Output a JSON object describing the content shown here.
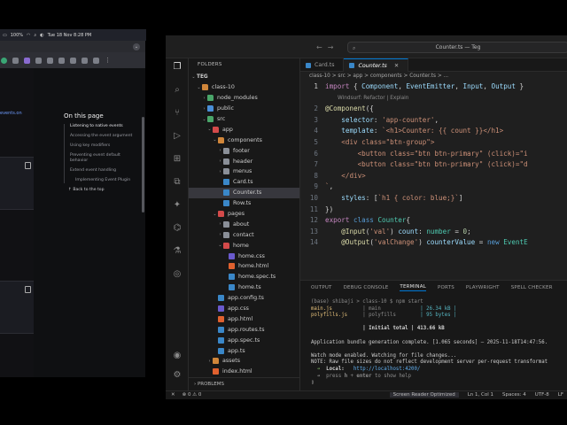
{
  "mac_menubar": {
    "date": "Tue 18 Nov 8:28 PM",
    "battery": "100%"
  },
  "browser": {
    "page_link_text": "events.on",
    "toc_title": "On this page",
    "toc_items": [
      {
        "label": "Listening to native events",
        "active": true,
        "sub": false
      },
      {
        "label": "Accessing the event argument",
        "active": false,
        "sub": false
      },
      {
        "label": "Using key modifiers",
        "active": false,
        "sub": false
      },
      {
        "label": "Preventing event default behavior",
        "active": false,
        "sub": false
      },
      {
        "label": "Extend event handling",
        "active": false,
        "sub": false
      },
      {
        "label": "Implementing Event Plugin",
        "active": false,
        "sub": true
      }
    ],
    "back_to_top": "Back to the top"
  },
  "vscode": {
    "window_title": "Counter.ts — Teg",
    "explorer": {
      "header": "FOLDERS",
      "root": "TEG",
      "problems_header": "PROBLEMS",
      "tree": [
        {
          "label": "class-10",
          "depth": 1,
          "type": "folder",
          "color": "orange",
          "open": true
        },
        {
          "label": "node_modules",
          "depth": 2,
          "type": "folder",
          "color": "green",
          "open": false
        },
        {
          "label": "public",
          "depth": 2,
          "type": "folder",
          "color": "blue",
          "open": false
        },
        {
          "label": "src",
          "depth": 2,
          "type": "folder",
          "color": "green",
          "open": true
        },
        {
          "label": "app",
          "depth": 3,
          "type": "folder",
          "color": "red",
          "open": true
        },
        {
          "label": "components",
          "depth": 4,
          "type": "folder",
          "color": "orange",
          "open": true
        },
        {
          "label": "footer",
          "depth": 5,
          "type": "folder",
          "color": "gray",
          "open": false
        },
        {
          "label": "header",
          "depth": 5,
          "type": "folder",
          "color": "gray",
          "open": false
        },
        {
          "label": "menus",
          "depth": 5,
          "type": "folder",
          "color": "gray",
          "open": false
        },
        {
          "label": "Card.ts",
          "depth": 5,
          "type": "ts"
        },
        {
          "label": "Counter.ts",
          "depth": 5,
          "type": "ts",
          "selected": true
        },
        {
          "label": "Row.ts",
          "depth": 5,
          "type": "ts"
        },
        {
          "label": "pages",
          "depth": 4,
          "type": "folder",
          "color": "red",
          "open": true
        },
        {
          "label": "about",
          "depth": 5,
          "type": "folder",
          "color": "gray",
          "open": false
        },
        {
          "label": "contact",
          "depth": 5,
          "type": "folder",
          "color": "gray",
          "open": false
        },
        {
          "label": "home",
          "depth": 5,
          "type": "folder",
          "color": "red",
          "open": true
        },
        {
          "label": "home.css",
          "depth": 6,
          "type": "css"
        },
        {
          "label": "home.html",
          "depth": 6,
          "type": "html"
        },
        {
          "label": "home.spec.ts",
          "depth": 6,
          "type": "ts"
        },
        {
          "label": "home.ts",
          "depth": 6,
          "type": "ts"
        },
        {
          "label": "app.config.ts",
          "depth": 4,
          "type": "ts"
        },
        {
          "label": "app.css",
          "depth": 4,
          "type": "css"
        },
        {
          "label": "app.html",
          "depth": 4,
          "type": "html"
        },
        {
          "label": "app.routes.ts",
          "depth": 4,
          "type": "ts"
        },
        {
          "label": "app.spec.ts",
          "depth": 4,
          "type": "ts"
        },
        {
          "label": "app.ts",
          "depth": 4,
          "type": "ts"
        },
        {
          "label": "assets",
          "depth": 3,
          "type": "folder",
          "color": "orange",
          "open": false
        },
        {
          "label": "index.html",
          "depth": 3,
          "type": "html"
        }
      ]
    },
    "tabs": [
      {
        "label": "Card.ts",
        "active": false
      },
      {
        "label": "Counter.ts",
        "active": true
      }
    ],
    "breadcrumbs": "class-10 > src > app > components > Counter.ts > ...",
    "codelens": "Windsurf: Refactor | Explain",
    "code_lines": [
      {
        "n": "1",
        "html": "<span class='kw2'>import</span> { <span class='pr'>Component</span>, <span class='pr'>EventEmitter</span>, <span class='pr'>Input</span>, <span class='pr'>Output</span> }"
      },
      {
        "n": "",
        "codelens": true
      },
      {
        "n": "2",
        "html": "<span class='dec'>@Component</span>({"
      },
      {
        "n": "3",
        "html": "    <span class='pr'>selector</span>: <span class='st'>'app-counter'</span>,"
      },
      {
        "n": "4",
        "html": "    <span class='pr'>template</span>: <span class='st'>`&lt;h1&gt;Counter: {{ count }}&lt;/h1&gt;</span>"
      },
      {
        "n": "5",
        "html": "    <span class='st'>&lt;div class=\"btn-group\"&gt;</span>"
      },
      {
        "n": "6",
        "html": "        <span class='st'>&lt;button class=\"btn btn-primary\" (click)=\"i</span>"
      },
      {
        "n": "7",
        "html": "        <span class='st'>&lt;button class=\"btn btn-primary\" (click)=\"d</span>"
      },
      {
        "n": "8",
        "html": "    <span class='st'>&lt;/div&gt;</span>"
      },
      {
        "n": "9",
        "html": "<span class='st'>`</span>,"
      },
      {
        "n": "10",
        "html": "    <span class='pr'>styles</span>: [<span class='st'>`h1 { color: blue;}`</span>]"
      },
      {
        "n": "11",
        "html": "})"
      },
      {
        "n": "12",
        "html": "<span class='kw2'>export</span> <span class='kw'>class</span> <span class='ty'>Counter</span>{"
      },
      {
        "n": "13",
        "html": "    <span class='dec'>@Input</span>(<span class='st'>'val'</span>) <span class='pr'>count</span>: <span class='ty'>number</span> = <span class='nu'>0</span>;"
      },
      {
        "n": "14",
        "html": "    <span class='dec'>@Output</span>(<span class='st'>'valChange'</span>) <span class='pr'>counterValue</span> = <span class='kw'>new</span> <span class='ty'>EventE</span>"
      }
    ],
    "panel_tabs": [
      "OUTPUT",
      "DEBUG CONSOLE",
      "TERMINAL",
      "PORTS",
      "PLAYWRIGHT",
      "SPELL CHECKER"
    ],
    "active_panel_tab": "TERMINAL",
    "terminal_lines": [
      "<span class='t-dim'>(base) shibaji &gt; class-10 $ npm start</span>",
      "<span class='t-y'>main.js</span>          <span class='t-dim'>| main</span>             <span class='t-c'>| 26.34 kB |</span>",
      "<span class='t-y'>polyfills.js</span>     <span class='t-dim'>| polyfills</span>        <span class='t-c'>| 95 bytes |</span>",
      "",
      "                 <span class='t-b'>| Initial total | 413.66 kB</span>",
      "",
      "Application bundle generation complete. [1.065 seconds] — 2025-11-18T14:47:56.",
      "",
      "Watch mode enabled. Watching for file changes...",
      "NOTE: Raw file sizes do not reflect development server per-request transformat",
      "  <span class='t-g'>➜</span>  <span class='t-b'>Local:</span>   <span class='t-link'>http://localhost:4200/</span>",
      "  <span class='t-dim'>➜  press <b>h</b> + <b>enter</b> to show help</span>",
      "▯"
    ],
    "status": {
      "left": [
        "✕",
        "⊗ 0 ⚠ 0"
      ],
      "reader": "Screen Reader Optimized",
      "position": "Ln 1, Col 1",
      "spaces": "Spaces: 4",
      "encoding": "UTF-8",
      "eol": "LF"
    }
  }
}
